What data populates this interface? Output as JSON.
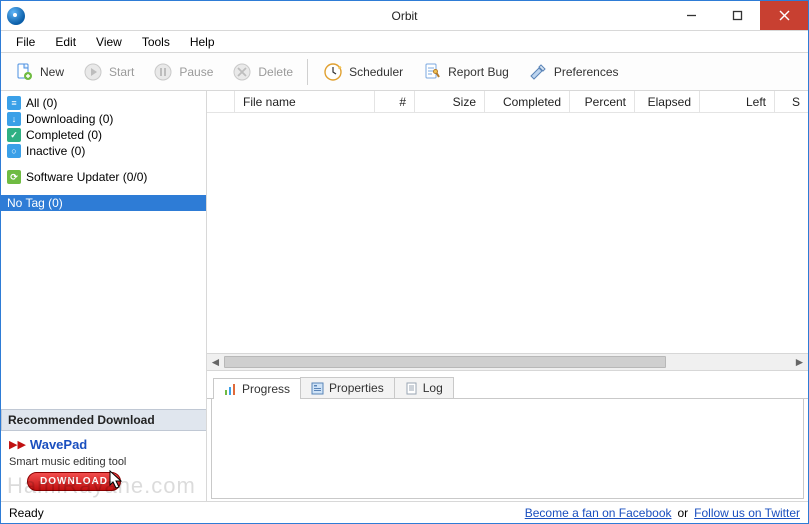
{
  "window": {
    "title": "Orbit"
  },
  "menubar": {
    "items": [
      "File",
      "Edit",
      "View",
      "Tools",
      "Help"
    ]
  },
  "toolbar": {
    "new": "New",
    "start": "Start",
    "pause": "Pause",
    "delete": "Delete",
    "scheduler": "Scheduler",
    "report_bug": "Report Bug",
    "preferences": "Preferences"
  },
  "sidebar": {
    "all": "All (0)",
    "downloading": "Downloading (0)",
    "completed": "Completed (0)",
    "inactive": "Inactive (0)",
    "updater": "Software Updater (0/0)",
    "no_tag": "No Tag (0)"
  },
  "recommend": {
    "heading": "Recommended Download",
    "product": "WavePad",
    "caption": "Smart music editing tool",
    "button": "DOWNLOAD"
  },
  "grid": {
    "columns": {
      "filename": "File name",
      "hash": "#",
      "size": "Size",
      "completed": "Completed",
      "percent": "Percent",
      "elapsed": "Elapsed",
      "left": "Left",
      "s": "S"
    }
  },
  "detail_tabs": {
    "progress": "Progress",
    "properties": "Properties",
    "log": "Log"
  },
  "statusbar": {
    "ready": "Ready",
    "fb": "Become a fan on Facebook",
    "or": "or",
    "tw": "Follow us on Twitter"
  },
  "watermark": "HamiRayane.com"
}
